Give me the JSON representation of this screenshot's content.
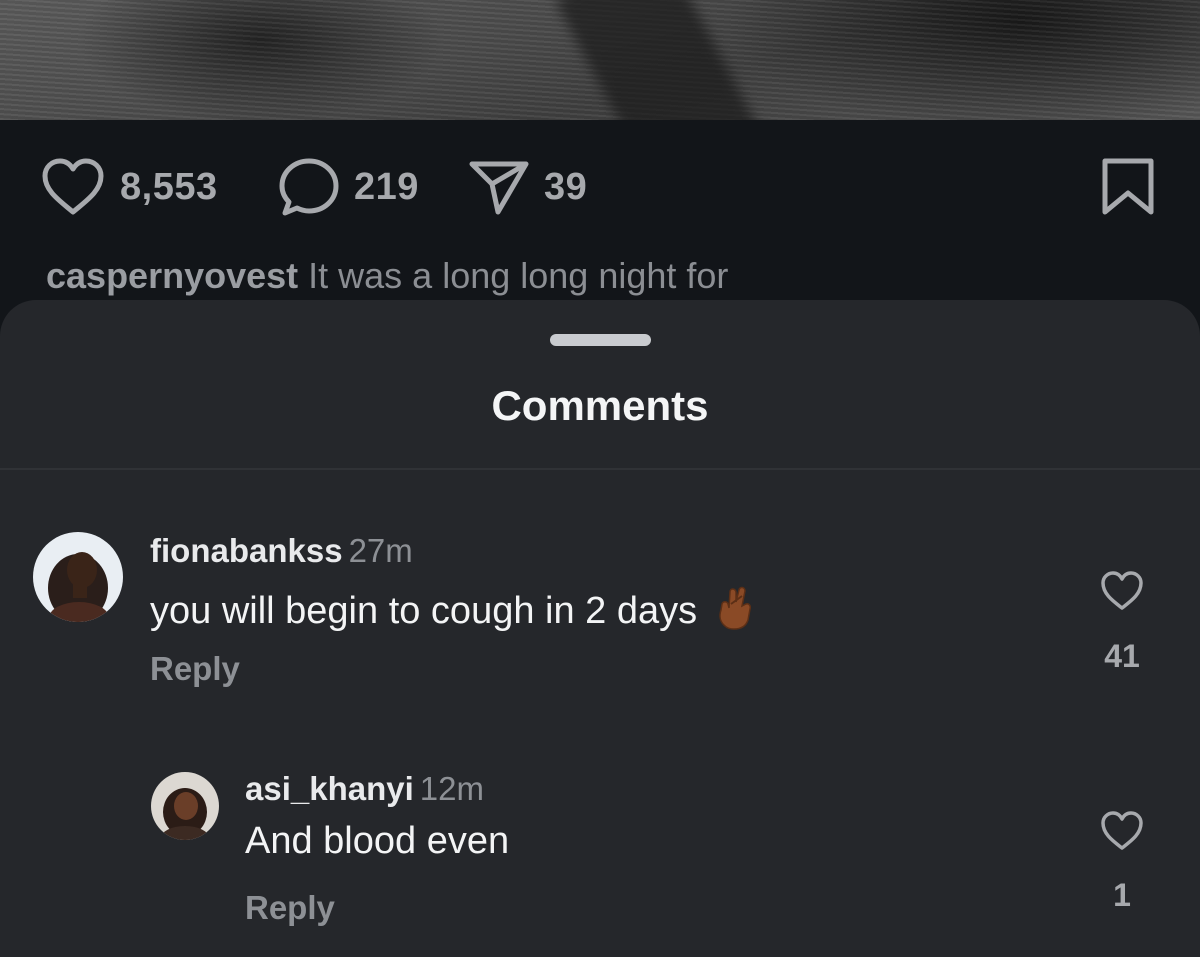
{
  "post": {
    "likes": "8,553",
    "comments": "219",
    "shares": "39",
    "caption_user": "caspernyovest",
    "caption_text": " It was a long long night for"
  },
  "sheet": {
    "title": "Comments"
  },
  "comments": [
    {
      "user": "fionabankss",
      "time": "27m",
      "text": "you will begin to cough in 2 days",
      "emoji": "crossed-fingers-icon",
      "reply_label": "Reply",
      "likes": "41"
    },
    {
      "user": "asi_khanyi",
      "time": "12m",
      "text": "And blood even",
      "reply_label": "Reply",
      "likes": "1"
    }
  ],
  "colors": {
    "background": "#121519",
    "sheet": "#25272b",
    "muted_text": "#8d9095",
    "primary_text": "#f3f4f5"
  }
}
